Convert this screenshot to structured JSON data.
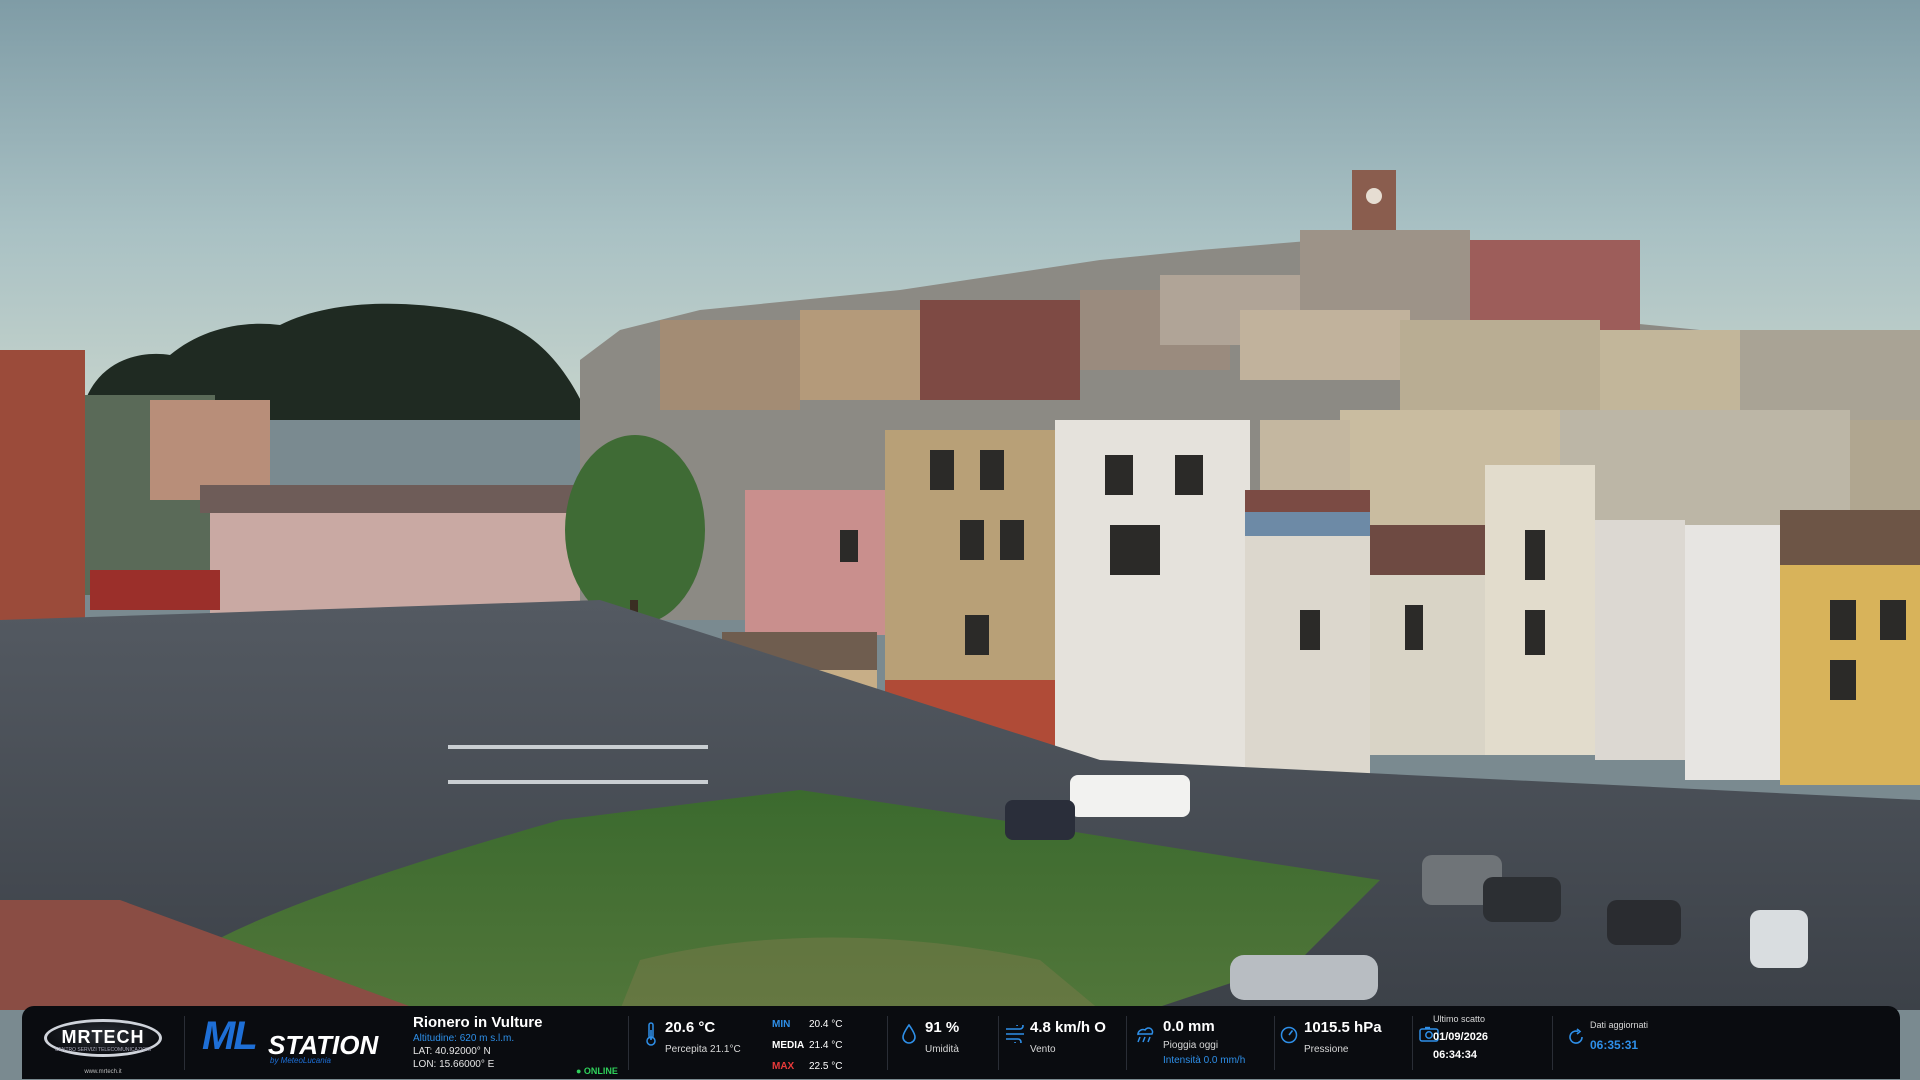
{
  "scene": {
    "description_alt": "Webcam view"
  },
  "overlay": {
    "brand_left": {
      "name": "MRTECH",
      "tagline": "CENTRO SERVIZI TELECOMUNICAZIONI",
      "site": "www.mrtech.it"
    },
    "brand_main": {
      "ml": "ML",
      "station": "STATION",
      "by": "by MeteoLucania"
    },
    "station": {
      "name": "Rionero in Vulture",
      "altitude": "Altitudine: 620 m s.l.m.",
      "lat": "LAT: 40.92000° N",
      "lon": "LON: 15.66000° E",
      "status": "● ONLINE"
    },
    "temperature": {
      "value": "20.6 °C",
      "feels": "Percepita 21.1°C",
      "min_label": "MIN",
      "min_value": "20.4 °C",
      "avg_label": "MEDIA",
      "avg_value": "21.4 °C",
      "max_label": "MAX",
      "max_value": "22.5 °C"
    },
    "humidity": {
      "value": "91 %",
      "label": "Umidità"
    },
    "wind": {
      "value": "4.8 km/h O",
      "label": "Vento"
    },
    "rain": {
      "value": "0.0 mm",
      "label": "Pioggia oggi",
      "intensity": "Intensità 0.0 mm/h"
    },
    "pressure": {
      "value": "1015.5 hPa",
      "label": "Pressione"
    },
    "last_shot": {
      "label": "Ultimo scatto",
      "date": "01/09/2026",
      "time": "06:34:34"
    },
    "updated": {
      "label": "Dati aggiornati",
      "time": "06:35:31"
    },
    "colors": {
      "accent_blue": "#2e8fe8",
      "min_color": "#2e8fe8",
      "avg_color": "#ffffff",
      "max_color": "#e83a3a",
      "online_green": "#2fd05a"
    }
  }
}
